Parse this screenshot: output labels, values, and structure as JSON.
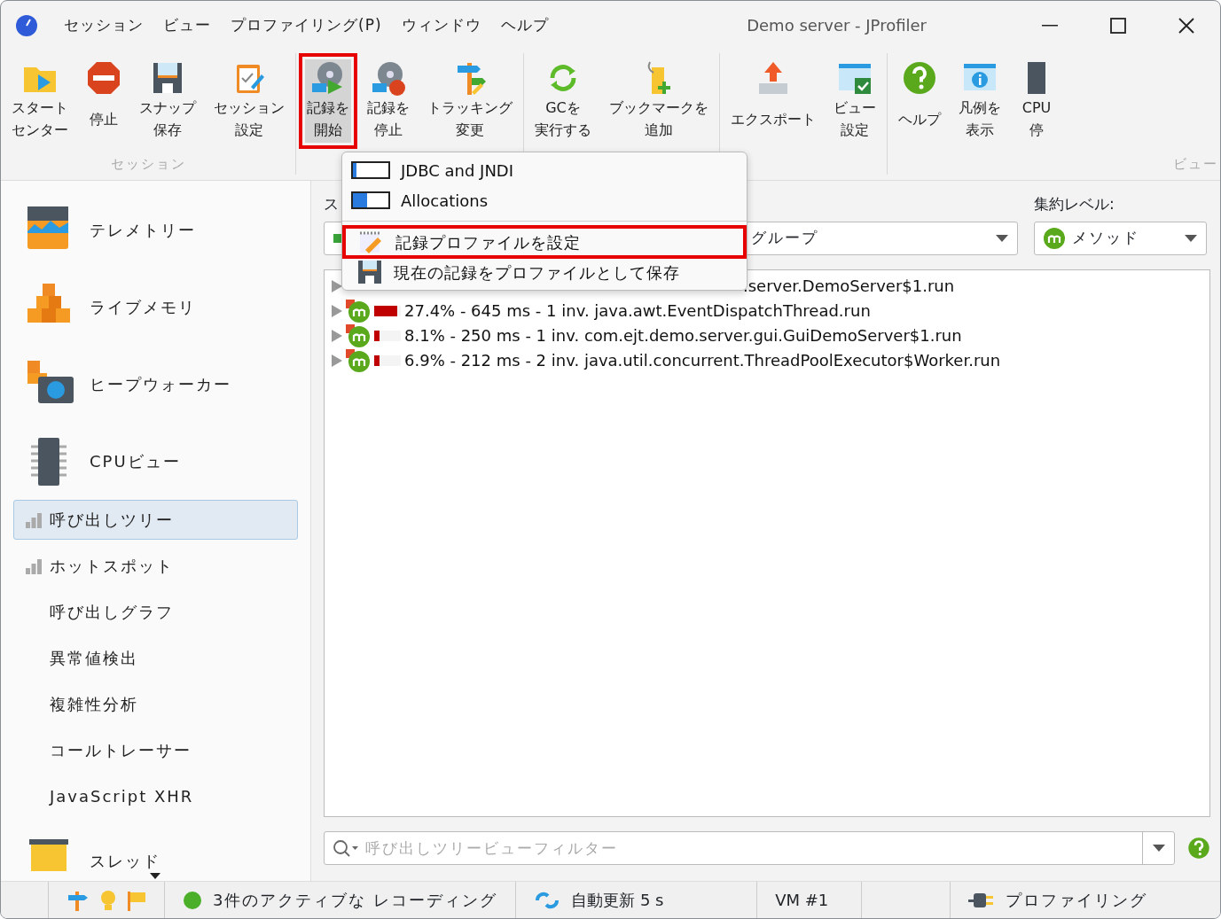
{
  "window": {
    "title": "Demo server - JProfiler",
    "menus": [
      "セッション",
      "ビュー",
      "プロファイリング(P)",
      "ウィンドウ",
      "ヘルプ"
    ]
  },
  "ribbon": {
    "groups": [
      {
        "label": "セッション",
        "buttons": [
          {
            "lines": [
              "スタート",
              "センター"
            ],
            "selected": false,
            "highlighted": false
          },
          {
            "lines": [
              "停止"
            ],
            "selected": false,
            "highlighted": false
          },
          {
            "lines": [
              "スナップ",
              "保存"
            ],
            "selected": false,
            "highlighted": false
          },
          {
            "lines": [
              "セッション",
              "設定"
            ],
            "selected": false,
            "highlighted": false
          }
        ]
      },
      {
        "buttons": [
          {
            "lines": [
              "記録を",
              "開始"
            ],
            "selected": true,
            "highlighted": true
          },
          {
            "lines": [
              "記録を",
              "停止"
            ],
            "selected": false,
            "highlighted": false
          },
          {
            "lines": [
              "トラッキング",
              "変更"
            ],
            "selected": false,
            "highlighted": false
          }
        ]
      },
      {
        "buttons": [
          {
            "lines": [
              "GCを",
              "実行する"
            ],
            "selected": false,
            "highlighted": false
          },
          {
            "lines": [
              "ブックマークを",
              "追加"
            ],
            "selected": false,
            "highlighted": false
          }
        ]
      },
      {
        "buttons": [
          {
            "lines": [
              "エクスポート"
            ],
            "selected": false,
            "highlighted": false
          },
          {
            "lines": [
              "ビュー",
              "設定"
            ],
            "selected": false,
            "highlighted": false
          }
        ]
      },
      {
        "label": "ビュー",
        "buttons": [
          {
            "lines": [
              "ヘルプ"
            ],
            "selected": false,
            "highlighted": false
          },
          {
            "lines": [
              "凡例を",
              "表示"
            ],
            "selected": false,
            "highlighted": false
          },
          {
            "lines": [
              "CPU",
              "停"
            ],
            "selected": false,
            "highlighted": false
          }
        ]
      }
    ]
  },
  "dropdown_menu": {
    "items": [
      {
        "kind": "profile",
        "label": "JDBC and JNDI",
        "highlighted": false
      },
      {
        "kind": "profile",
        "label": "Allocations",
        "highlighted": false
      },
      {
        "kind": "separator"
      },
      {
        "kind": "action",
        "label": "記録プロファイルを設定",
        "highlighted": true
      },
      {
        "kind": "action",
        "label": "現在の記録をプロファイルとして保存",
        "highlighted": false
      }
    ]
  },
  "sidebar": {
    "items": [
      {
        "kind": "large",
        "label": "テレメトリー",
        "selected": false
      },
      {
        "kind": "large",
        "label": "ライブメモリ",
        "selected": false
      },
      {
        "kind": "large",
        "label": "ヒープウォーカー",
        "selected": false
      },
      {
        "kind": "large",
        "label": "CPUビュー",
        "selected": false
      },
      {
        "kind": "small",
        "label": "呼び出しツリー",
        "selected": true,
        "recording": true
      },
      {
        "kind": "small",
        "label": "ホットスポット",
        "selected": false,
        "recording": true
      },
      {
        "kind": "small",
        "label": "呼び出しグラフ",
        "selected": false,
        "recording": false
      },
      {
        "kind": "small",
        "label": "異常値検出",
        "selected": false,
        "recording": false
      },
      {
        "kind": "small",
        "label": "複雑性分析",
        "selected": false,
        "recording": false
      },
      {
        "kind": "small",
        "label": "コールトレーサー",
        "selected": false,
        "recording": false
      },
      {
        "kind": "small",
        "label": "JavaScript XHR",
        "selected": false,
        "recording": false
      },
      {
        "kind": "large",
        "label": "スレッド",
        "selected": false
      }
    ]
  },
  "controls": {
    "thread_label": "ス",
    "thread_group": "グループ",
    "aggregation_label": "集約レベル:",
    "aggregation_level": "メソッド"
  },
  "call_tree": {
    "rows": [
      {
        "text": ".server.DemoServer$1.run"
      },
      {
        "text": "27.4% - 645 ms - 1 inv. java.awt.EventDispatchThread.run",
        "level": 0.85
      },
      {
        "text": "8.1% - 250 ms - 1 inv. com.ejt.demo.server.gui.GuiDemoServer$1.run",
        "level": 0.2
      },
      {
        "text": "6.9% - 212 ms - 2 inv. java.util.concurrent.ThreadPoolExecutor$Worker.run",
        "level": 0.2
      }
    ]
  },
  "filter": {
    "placeholder": "呼び出しツリービューフィルター"
  },
  "status_bar": {
    "recordings": "3件のアクティブな レコーディング",
    "auto_update": "自動更新 5 s",
    "vm": "VM #1",
    "mode": "プロファイリング"
  }
}
